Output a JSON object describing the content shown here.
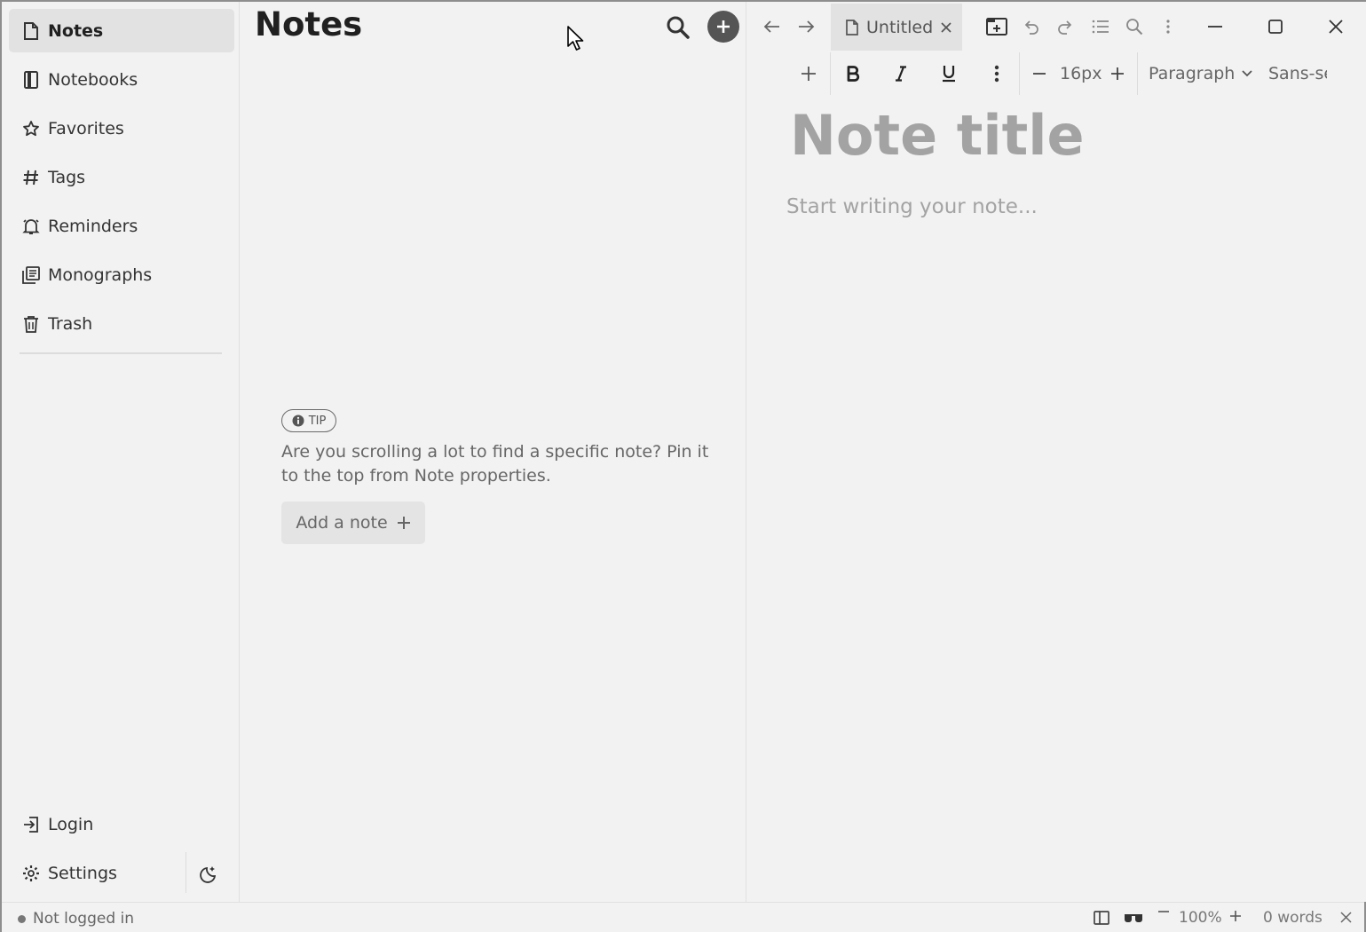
{
  "sidebar": {
    "items": [
      {
        "label": "Notes",
        "icon": "note-icon",
        "active": true
      },
      {
        "label": "Notebooks",
        "icon": "notebook-icon"
      },
      {
        "label": "Favorites",
        "icon": "star-icon"
      },
      {
        "label": "Tags",
        "icon": "hash-icon"
      },
      {
        "label": "Reminders",
        "icon": "bell-icon"
      },
      {
        "label": "Monographs",
        "icon": "monograph-icon"
      },
      {
        "label": "Trash",
        "icon": "trash-icon"
      }
    ],
    "login_label": "Login",
    "settings_label": "Settings"
  },
  "list": {
    "title": "Notes",
    "tip_badge": "TIP",
    "tip_text": "Are you scrolling a lot to find a specific note? Pin it to the top from Note properties.",
    "add_note_label": "Add a note"
  },
  "editor": {
    "tab_title": "Untitled",
    "font_size": "16px",
    "block_type": "Paragraph",
    "font_family": "Sans-serif",
    "title_placeholder": "Note title",
    "body_placeholder": "Start writing your note..."
  },
  "status": {
    "login_state": "Not logged in",
    "zoom": "100%",
    "word_count": "0 words"
  },
  "colors": {
    "background": "#f2f2f2",
    "active_item": "#e2e2e2",
    "placeholder": "#a3a3a3",
    "accent_button": "#555555"
  }
}
